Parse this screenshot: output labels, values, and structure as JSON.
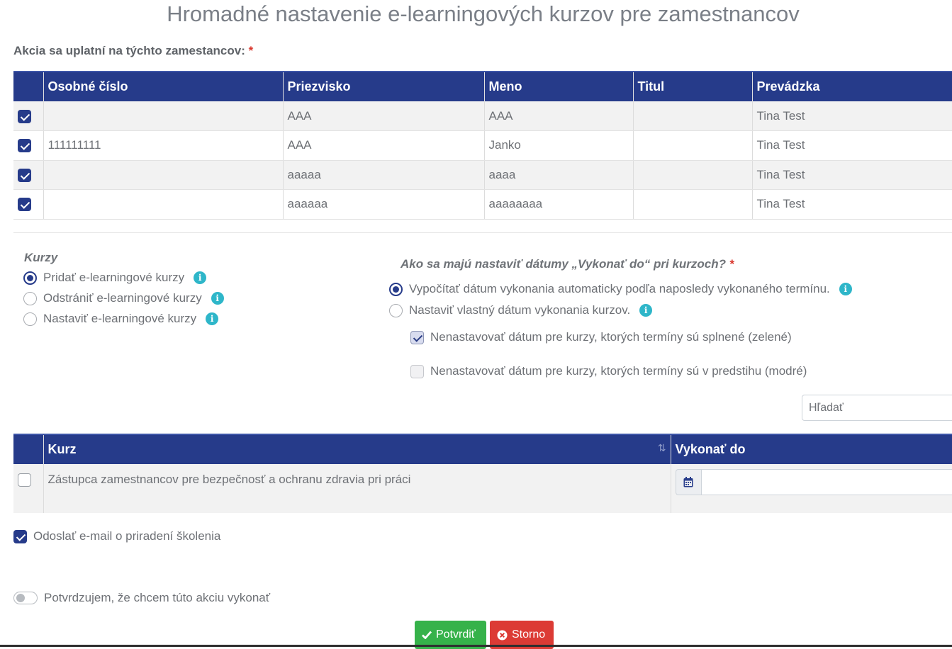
{
  "title": "Hromadné nastavenie e-learningových kurzov pre zamestnancov",
  "employees": {
    "label": "Akcia sa uplatní na týchto zamestancov:",
    "required_mark": "*",
    "columns": [
      "",
      "Osobné číslo",
      "Priezvisko",
      "Meno",
      "Titul",
      "Prevádzka"
    ],
    "rows": [
      {
        "checked": true,
        "id": "",
        "surname": "AAA",
        "name": "AAA",
        "title": "",
        "unit": "Tina Test"
      },
      {
        "checked": true,
        "id": "111111111",
        "surname": "AAA",
        "name": "Janko",
        "title": "",
        "unit": "Tina Test"
      },
      {
        "checked": true,
        "id": "",
        "surname": "aaaaa",
        "name": "aaaa",
        "title": "",
        "unit": "Tina Test"
      },
      {
        "checked": true,
        "id": "",
        "surname": "aaaaaa",
        "name": "aaaaaaaa",
        "title": "",
        "unit": "Tina Test"
      }
    ]
  },
  "courses_section": {
    "heading": "Kurzy",
    "options": [
      {
        "label": "Pridať e-learningové kurzy",
        "selected": true
      },
      {
        "label": "Odstrániť e-learningové kurzy",
        "selected": false
      },
      {
        "label": "Nastaviť e-learningové kurzy",
        "selected": false
      }
    ]
  },
  "dates_section": {
    "heading": "Ako sa majú nastaviť dátumy „Vykonať do“ pri kurzoch?",
    "required_mark": "*",
    "options": [
      {
        "label": "Vypočítať dátum vykonania automaticky podľa naposledy vykonaného termínu.",
        "selected": true
      },
      {
        "label": "Nastaviť vlastný dátum vykonania kurzov.",
        "selected": false
      }
    ],
    "sub_options": [
      {
        "label": "Nenastavovať dátum pre kurzy, ktorých termíny sú splnené (zelené)",
        "checked": true
      },
      {
        "label": "Nenastavovať dátum pre kurzy, ktorých termíny sú v predstihu (modré)",
        "checked": false
      }
    ]
  },
  "search": {
    "placeholder": "Hľadať"
  },
  "course_table": {
    "columns": [
      "",
      "Kurz",
      "Vykonať do"
    ],
    "rows": [
      {
        "checked": false,
        "course": "Zástupca zamestnancov pre bezpečnosť a ochranu zdravia pri práci",
        "due": ""
      }
    ]
  },
  "send_email": {
    "label": "Odoslať e-mail o priradení školenia",
    "checked": true
  },
  "confirm_toggle": {
    "label": "Potvrdzujem, že chcem túto akciu vykonať",
    "on": false
  },
  "buttons": {
    "confirm": "Potvrdiť",
    "cancel": "Storno"
  },
  "colors": {
    "header": "#263b8a",
    "info": "#2eb6c9",
    "confirm": "#36b24a",
    "cancel": "#dc3b35"
  }
}
